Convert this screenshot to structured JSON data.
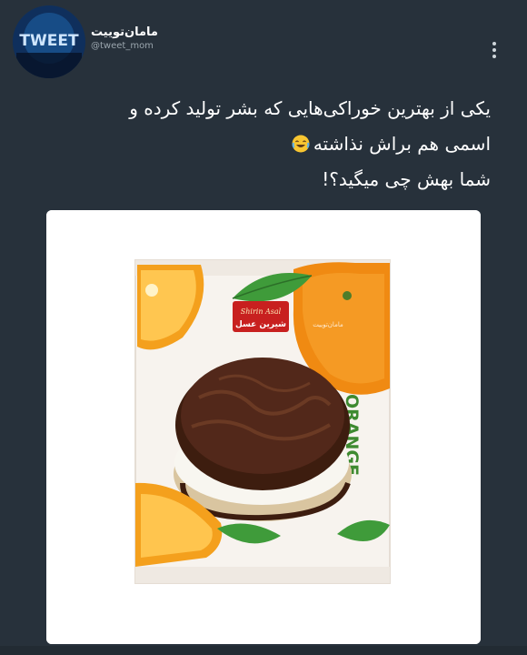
{
  "profile": {
    "display_name": "مامان‌توییت",
    "handle": "@tweet_mom",
    "avatar_text": "TWEET"
  },
  "tweet": {
    "lines": [
      "یکی از بهترین خوراکی‌هایی که بشر تولید کرده و",
      "اسمی هم براش نذاشته",
      "شما بهش چی میگید؟!"
    ],
    "emoji": "face-with-tears-of-joy"
  },
  "media": {
    "product_brand_latin": "Shirin Asal",
    "product_brand_fa": "شیرین عسل",
    "product_flavor": "ORANGE",
    "watermark": "مامان‌توییت"
  },
  "colors": {
    "background": "#27313b",
    "chocolate": "#4a2414",
    "orange": "#f29a1c",
    "leaf": "#3f9b3a",
    "brand_red": "#c8201f"
  }
}
